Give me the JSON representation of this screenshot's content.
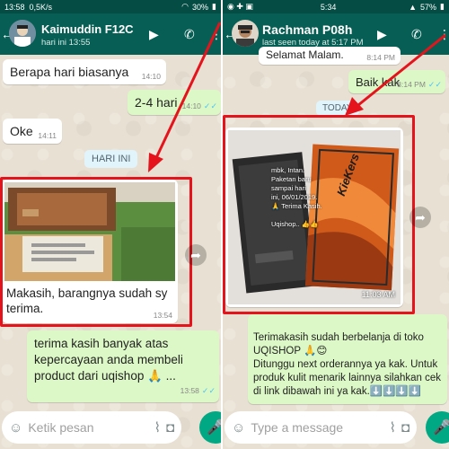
{
  "left": {
    "status": {
      "time": "13:58",
      "speed": "0,5K/s",
      "battery": "30%"
    },
    "header": {
      "name": "Kaimuddin F12C",
      "subtitle": "hari ini 13:55"
    },
    "messages": [
      {
        "text": "Berapa hari biasanya",
        "time": "14:10"
      },
      {
        "text": "2-4 hari",
        "time": "14:10"
      },
      {
        "text": "Oke",
        "time": "14:11"
      }
    ],
    "day_chip": "HARI INI",
    "photo_caption": "Makasih, barangnya sudah sy terima.",
    "photo_time": "13:54",
    "reply_text": "terima kasih banyak atas kepercayaan anda membeli product dari uqishop 🙏 ...",
    "reply_time": "13:58",
    "compose_placeholder": "Ketik pesan"
  },
  "right": {
    "status": {
      "time": "5:34",
      "battery": "57%"
    },
    "header": {
      "name": "Rachman P08h",
      "subtitle": "last seen today at 5:17 PM"
    },
    "messages": [
      {
        "text": "Selamat Malam.",
        "time": "8:14 PM"
      },
      {
        "text": "Baik kak",
        "time": "8:14 PM"
      }
    ],
    "day_chip": "TODAY",
    "photo_overlay": "mbk, Intan.\nPaketan baru\nsampai hari\nini, 06/01/2019.\n🙏 Terima Kasih.\n\nUqishop.. 👍👍",
    "photo_time": "11:03 AM",
    "box_brand": "KieKers",
    "reply_text": "Terimakasih sudah berbelanja di toko UQISHOP 🙏😊\nDitunggu next orderannya ya kak. Untuk produk kulit menarik lainnya silahkan cek di link dibawah ini ya kak.⬇️⬇️⬇️⬇️",
    "compose_placeholder": "Type a message"
  },
  "colors": {
    "header": "#075e54",
    "outgoing": "#dcf8c6",
    "highlight": "#e5141c",
    "mic": "#00a884"
  }
}
